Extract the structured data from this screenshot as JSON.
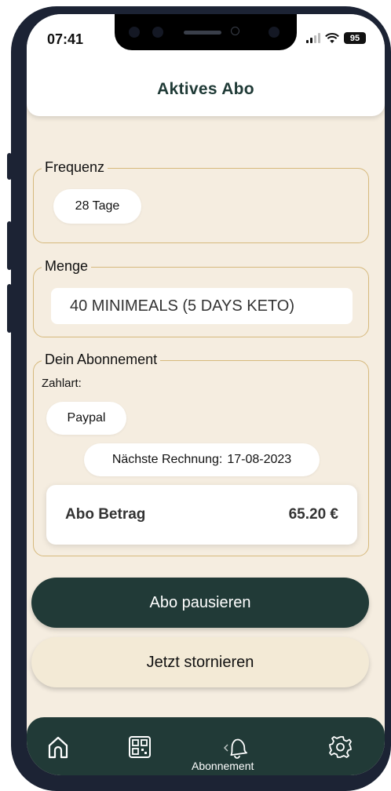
{
  "status_bar": {
    "time": "07:41",
    "battery": "95"
  },
  "header": {
    "title": "Aktives Abo"
  },
  "frequency": {
    "legend": "Frequenz",
    "value": "28 Tage"
  },
  "quantity": {
    "legend": "Menge",
    "value": "40 MINIMEALS (5 DAYS KETO)"
  },
  "subscription": {
    "legend": "Dein Abonnement",
    "payment_label": "Zahlart:",
    "payment_value": "Paypal",
    "next_invoice_label": "Nächste Rechnung:",
    "next_invoice_date": "17-08-2023",
    "amount_label": "Abo Betrag",
    "amount_value": "65.20 €"
  },
  "actions": {
    "pause": "Abo pausieren",
    "cancel": "Jetzt stornieren"
  },
  "tabbar": {
    "items": [
      {
        "icon": "home-icon"
      },
      {
        "icon": "qr-code-icon"
      },
      {
        "icon": "bell-icon",
        "label": "Abonnement",
        "active": true
      },
      {
        "icon": "gear-icon"
      }
    ]
  },
  "colors": {
    "primary": "#213a37",
    "background": "#f5ede0",
    "border": "#d6b97c",
    "cancel_bg": "#f3ead6"
  }
}
